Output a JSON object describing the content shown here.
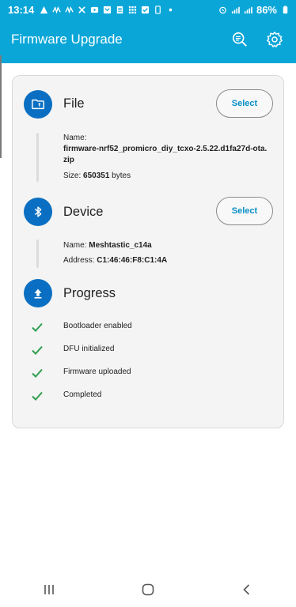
{
  "status_bar": {
    "time": "13:14",
    "battery": "86%",
    "left_icons": [
      "alert-icon",
      "signal-wave-icon",
      "signal-wave-icon",
      "x-logo-icon",
      "youtube-icon",
      "mail-icon",
      "document-icon",
      "grid-icon",
      "checkbox-icon",
      "phone-icon",
      "dot-icon"
    ],
    "right_icons": [
      "alarm-icon",
      "wifi-signal-icon",
      "cell-signal-icon"
    ]
  },
  "app_bar": {
    "title": "Firmware Upgrade",
    "actions": [
      "search-list-icon",
      "settings-icon"
    ],
    "background": "#0aa6d8"
  },
  "file_section": {
    "title": "File",
    "select_label": "Select",
    "name_label": "Name:",
    "name_value_line1": "firmware-nrf52_promicro_diy_tcxo-2.5.22.d1fa27d-ota.",
    "name_value_line2": "zip",
    "size_label": "Size:",
    "size_value": "650351",
    "size_unit": "bytes"
  },
  "device_section": {
    "title": "Device",
    "select_label": "Select",
    "name_label": "Name:",
    "name_value": "Meshtastic_c14a",
    "address_label": "Address:",
    "address_value": "C1:46:46:F8:C1:4A"
  },
  "progress_section": {
    "title": "Progress",
    "steps": [
      {
        "label": "Bootloader enabled",
        "status": "done"
      },
      {
        "label": "DFU initialized",
        "status": "done"
      },
      {
        "label": "Firmware uploaded",
        "status": "done"
      },
      {
        "label": "Completed",
        "status": "done"
      }
    ]
  },
  "colors": {
    "accent": "#0aa6d8",
    "section_icon": "#0a6fc2",
    "check": "#2e9e4f",
    "select_text": "#0a8fc6"
  },
  "nav_bar": {
    "buttons": [
      "recent-apps-icon",
      "home-icon",
      "back-icon"
    ]
  }
}
